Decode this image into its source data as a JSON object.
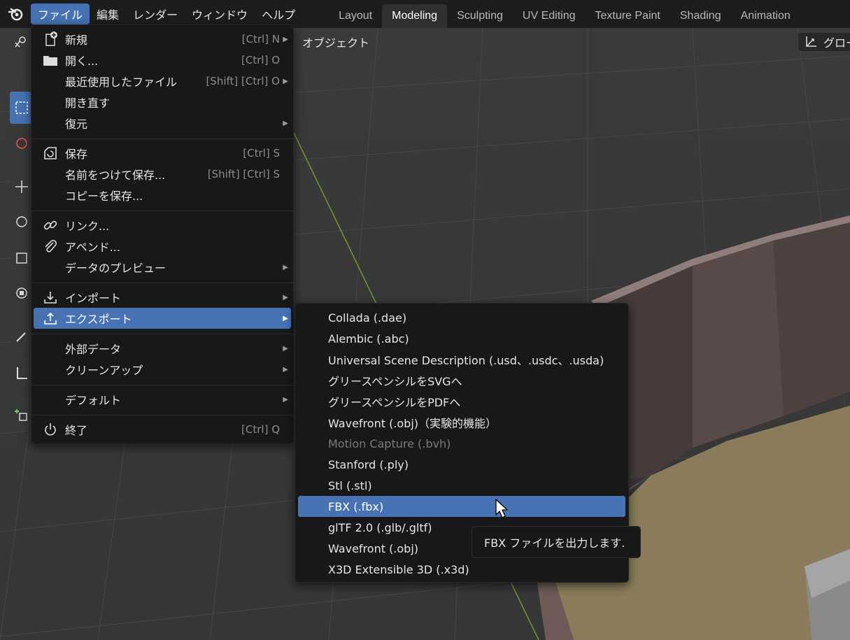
{
  "topbar": {
    "menus": [
      {
        "label": "ファイル",
        "active": true
      },
      {
        "label": "編集",
        "active": false
      },
      {
        "label": "レンダー",
        "active": false
      },
      {
        "label": "ウィンドウ",
        "active": false
      },
      {
        "label": "ヘルプ",
        "active": false
      }
    ],
    "workspaces": [
      {
        "label": "Layout",
        "active": false
      },
      {
        "label": "Modeling",
        "active": true
      },
      {
        "label": "Sculpting",
        "active": false
      },
      {
        "label": "UV Editing",
        "active": false
      },
      {
        "label": "Texture Paint",
        "active": false
      },
      {
        "label": "Shading",
        "active": false
      },
      {
        "label": "Animation",
        "active": false
      }
    ]
  },
  "header": {
    "object_label": "オブジェクト",
    "orientation_label": "グロー"
  },
  "file_menu": {
    "items": [
      {
        "label": "新規",
        "shortcut": "[Ctrl] N",
        "submenu": true,
        "icon": "new-file-icon"
      },
      {
        "label": "開く...",
        "shortcut": "[Ctrl] O",
        "submenu": false,
        "icon": "folder-icon"
      },
      {
        "label": "最近使用したファイル",
        "shortcut": "[Shift] [Ctrl] O",
        "submenu": true,
        "icon": ""
      },
      {
        "label": "開き直す",
        "shortcut": "",
        "submenu": false,
        "icon": ""
      },
      {
        "label": "復元",
        "shortcut": "",
        "submenu": true,
        "icon": ""
      },
      {
        "label": "保存",
        "shortcut": "[Ctrl] S",
        "submenu": false,
        "icon": "save-icon"
      },
      {
        "label": "名前をつけて保存...",
        "shortcut": "[Shift] [Ctrl] S",
        "submenu": false,
        "icon": ""
      },
      {
        "label": "コピーを保存...",
        "shortcut": "",
        "submenu": false,
        "icon": ""
      },
      {
        "label": "リンク...",
        "shortcut": "",
        "submenu": false,
        "icon": "link-icon"
      },
      {
        "label": "アペンド...",
        "shortcut": "",
        "submenu": false,
        "icon": "paperclip-icon"
      },
      {
        "label": "データのプレビュー",
        "shortcut": "",
        "submenu": true,
        "icon": ""
      },
      {
        "label": "インポート",
        "shortcut": "",
        "submenu": true,
        "icon": "import-icon"
      },
      {
        "label": "エクスポート",
        "shortcut": "",
        "submenu": true,
        "icon": "export-icon",
        "highlighted": true
      },
      {
        "label": "外部データ",
        "shortcut": "",
        "submenu": true,
        "icon": ""
      },
      {
        "label": "クリーンアップ",
        "shortcut": "",
        "submenu": true,
        "icon": ""
      },
      {
        "label": "デフォルト",
        "shortcut": "",
        "submenu": true,
        "icon": ""
      },
      {
        "label": "終了",
        "shortcut": "[Ctrl] Q",
        "submenu": false,
        "icon": "power-icon"
      }
    ]
  },
  "export_menu": {
    "items": [
      {
        "label": "Collada (.dae)"
      },
      {
        "label": "Alembic (.abc)"
      },
      {
        "label": "Universal Scene Description (.usd、.usdc、.usda)"
      },
      {
        "label": "グリースペンシルをSVGへ"
      },
      {
        "label": "グリースペンシルをPDFへ"
      },
      {
        "label": "Wavefront (.obj)（実験的機能）"
      },
      {
        "label": "Motion Capture (.bvh)",
        "disabled": true
      },
      {
        "label": "Stanford (.ply)"
      },
      {
        "label": "Stl (.stl)"
      },
      {
        "label": "FBX (.fbx)",
        "highlighted": true
      },
      {
        "label": "glTF 2.0 (.glb/.gltf)"
      },
      {
        "label": "Wavefront (.obj)"
      },
      {
        "label": "X3D Extensible 3D (.x3d)"
      }
    ]
  },
  "tooltip": {
    "text": "FBX ファイルを出力します."
  },
  "colors": {
    "accent": "#4772b3",
    "menu_bg": "#181818",
    "viewport_bg": "#393939"
  }
}
